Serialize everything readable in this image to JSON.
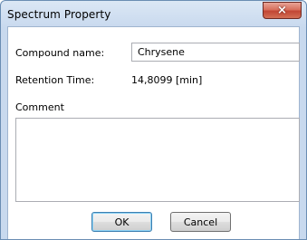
{
  "window": {
    "title": "Spectrum Property",
    "close_glyph": "×"
  },
  "form": {
    "compound_name_label": "Compound name:",
    "compound_name_value": "Chrysene",
    "retention_time_label": "Retention Time:",
    "retention_time_value": "14,8099 [min]",
    "comment_label": "Comment",
    "comment_value": ""
  },
  "buttons": {
    "ok_label": "OK",
    "cancel_label": "Cancel"
  },
  "colors": {
    "title_bar": "#c8d9ee",
    "close_button": "#c24634",
    "default_button_border": "#3c7fb1"
  }
}
